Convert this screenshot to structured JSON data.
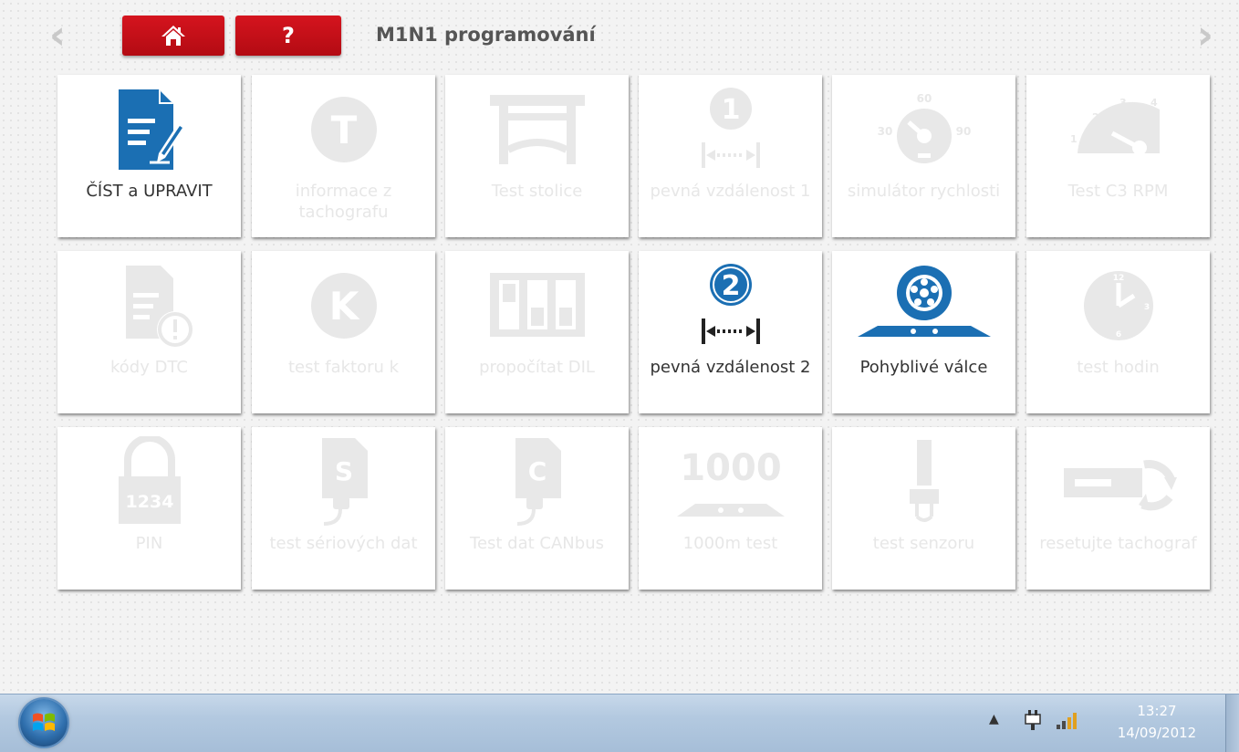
{
  "header": {
    "title": "M1N1 programování",
    "home_icon": "home-icon",
    "help_label": "?"
  },
  "tiles": [
    {
      "label": "ČÍST a UPRAVIT",
      "icon": "read-edit-document-icon",
      "enabled": true
    },
    {
      "label": "informace z tachografu",
      "icon": "tachograph-info-icon",
      "enabled": false
    },
    {
      "label": "Test stolice",
      "icon": "test-bench-icon",
      "enabled": false
    },
    {
      "label": "pevná vzdálenost 1",
      "icon": "fixed-distance-1-icon",
      "enabled": false
    },
    {
      "label": "simulátor rychlosti",
      "icon": "speed-simulator-icon",
      "enabled": false
    },
    {
      "label": "Test C3 RPM",
      "icon": "rpm-gauge-icon",
      "enabled": false
    },
    {
      "label": "kódy DTC",
      "icon": "dtc-codes-icon",
      "enabled": false
    },
    {
      "label": "test faktoru k",
      "icon": "k-factor-icon",
      "enabled": false
    },
    {
      "label": "propočítat DIL",
      "icon": "dil-switch-icon",
      "enabled": false
    },
    {
      "label": "pevná vzdálenost 2",
      "icon": "fixed-distance-2-icon",
      "enabled": true
    },
    {
      "label": "Pohyblivé válce",
      "icon": "rolling-road-icon",
      "enabled": true
    },
    {
      "label": "test hodin",
      "icon": "clock-icon",
      "enabled": false
    },
    {
      "label": "PIN",
      "icon": "pin-lock-icon",
      "enabled": false
    },
    {
      "label": "test sériových dat",
      "icon": "serial-data-icon",
      "enabled": false
    },
    {
      "label": "Test dat CANbus",
      "icon": "canbus-data-icon",
      "enabled": false
    },
    {
      "label": "1000m test",
      "icon": "1000m-test-icon",
      "enabled": false
    },
    {
      "label": "test senzoru",
      "icon": "sensor-icon",
      "enabled": false
    },
    {
      "label": "resetujte tachograf",
      "icon": "reset-tachograph-icon",
      "enabled": false
    }
  ],
  "icon_text": {
    "one": "1",
    "two": "2",
    "t": "T",
    "k": "K",
    "s": "S",
    "c": "C",
    "pin": "1234",
    "thousand": "1000",
    "speed_30": "30",
    "speed_60": "60",
    "speed_90": "90",
    "rpm_1": "1",
    "rpm_2": "2",
    "rpm_3": "3",
    "rpm_4": "4",
    "clock_12": "12",
    "clock_3": "3",
    "clock_6": "6"
  },
  "taskbar": {
    "time": "13:27",
    "date": "14/09/2012"
  },
  "colors": {
    "accent_red": "#c8101a",
    "icon_blue": "#1b6fb3",
    "disabled_gray": "#e8e8e8",
    "taskbar": "#b3c9e0"
  }
}
